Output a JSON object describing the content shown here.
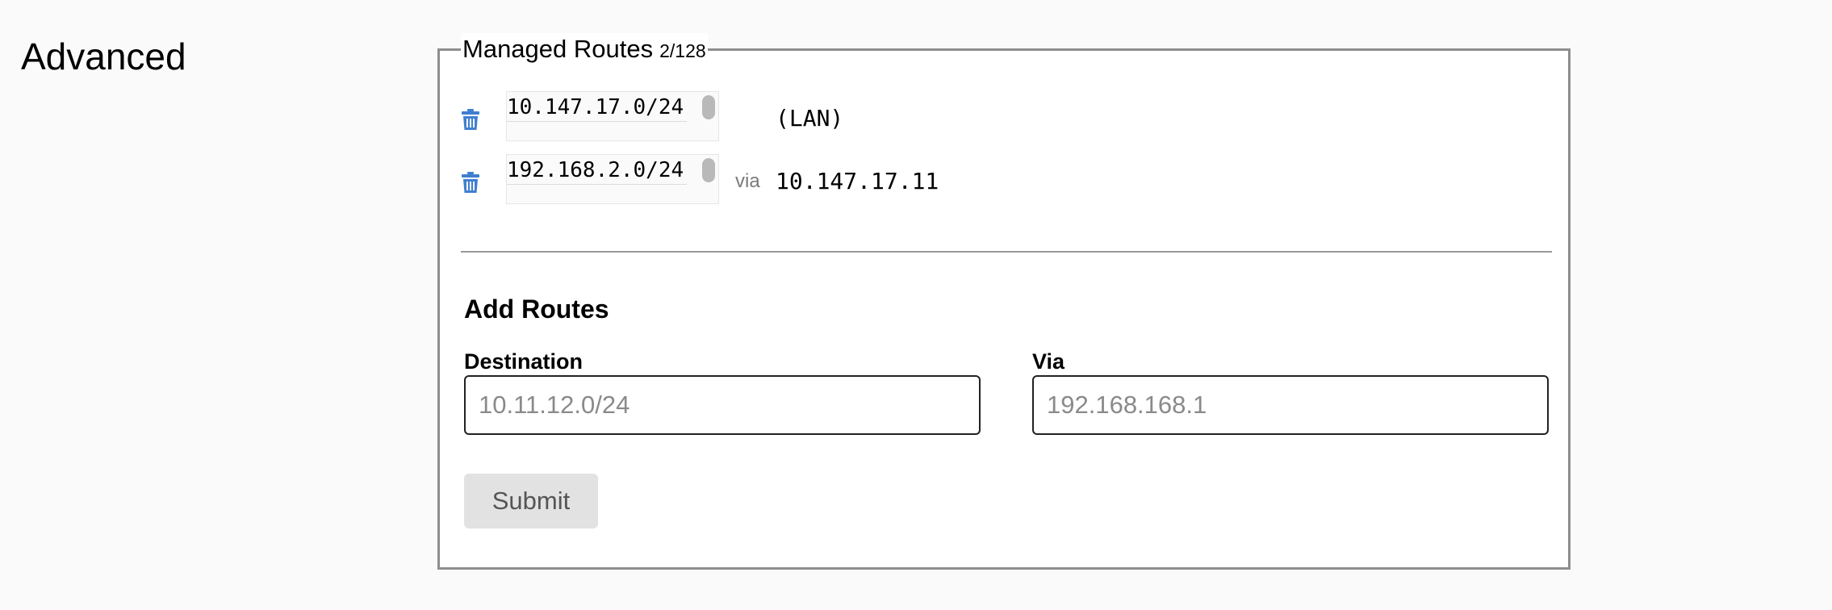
{
  "page": {
    "section_title": "Advanced"
  },
  "managed_routes": {
    "title": "Managed Routes",
    "count": "2/128",
    "routes": [
      {
        "destination": "10.147.17.0/24",
        "via_label": "",
        "via": "(LAN)"
      },
      {
        "destination": "192.168.2.0/24",
        "via_label": "via",
        "via": "10.147.17.11"
      }
    ],
    "delete_icon": "trash-icon",
    "accent_color": "#3f7fcf"
  },
  "add_routes": {
    "title": "Add Routes",
    "destination_label": "Destination",
    "destination_placeholder": "10.11.12.0/24",
    "destination_value": "",
    "via_label": "Via",
    "via_placeholder": "192.168.168.1",
    "via_value": "",
    "submit_label": "Submit"
  }
}
